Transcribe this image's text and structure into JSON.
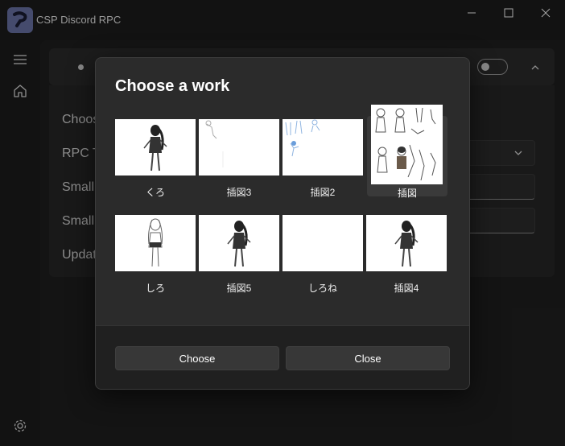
{
  "app": {
    "title": "CSP Discord RPC"
  },
  "settings": {
    "labels": [
      "Choos",
      "RPC Te",
      "Small",
      "Small",
      "Updat"
    ]
  },
  "dialog": {
    "title": "Choose a work",
    "works": [
      {
        "label": "くろ",
        "selected": false
      },
      {
        "label": "插図3",
        "selected": false
      },
      {
        "label": "插図2",
        "selected": false
      },
      {
        "label": "插図",
        "selected": true
      },
      {
        "label": "しろ",
        "selected": false
      },
      {
        "label": "插図5",
        "selected": false
      },
      {
        "label": "しろね",
        "selected": false
      },
      {
        "label": "插図4",
        "selected": false
      }
    ],
    "choose_label": "Choose",
    "close_label": "Close"
  },
  "colors": {
    "accent": "#6a73a8",
    "background": "#1c1c1c",
    "dialog": "#2b2b2b"
  }
}
